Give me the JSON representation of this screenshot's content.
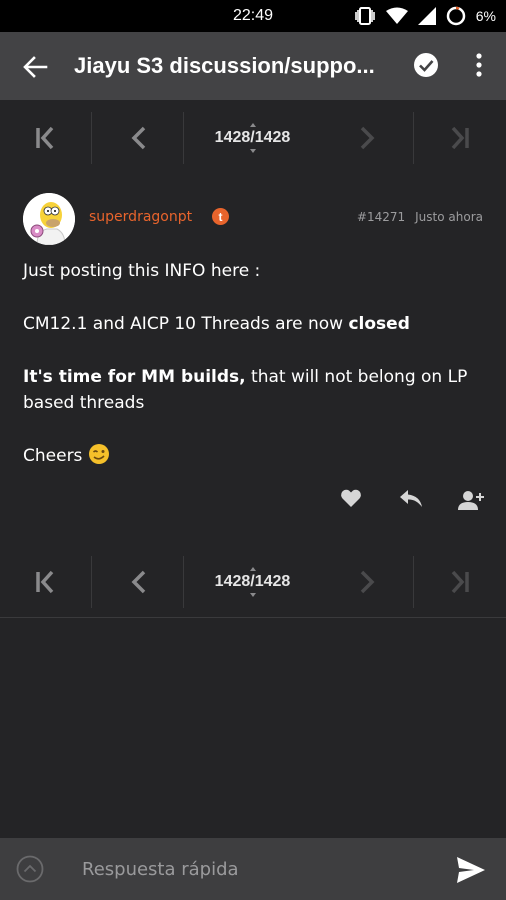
{
  "status_bar": {
    "time": "22:49",
    "battery": "6%",
    "icons": [
      "vibrate-icon",
      "wifi-icon",
      "signal-icon",
      "battery-icon"
    ]
  },
  "app_bar": {
    "title": "Jiayu S3 discussion/suppo...",
    "icons": [
      "back-arrow-icon",
      "check-circle-icon",
      "more-vert-icon"
    ]
  },
  "pager_top": {
    "page_current": "1428",
    "page_total": "1428"
  },
  "pager_bottom": {
    "page_current": "1428",
    "page_total": "1428"
  },
  "post": {
    "author": "superdragonpt",
    "badge": "t",
    "number": "#14271",
    "time": "Justo ahora",
    "line1": "Just posting this INFO here :",
    "line2_pre": "CM12.1 and AICP 10 Threads are now ",
    "line2_bold": "closed",
    "line3_bold": "It's time for MM builds,",
    "line3_rest": " that will not belong on LP based threads",
    "line4": "Cheers",
    "actions": [
      "heart-icon",
      "reply-icon",
      "add-user-icon"
    ]
  },
  "reply": {
    "placeholder": "Respuesta rápida"
  },
  "colors": {
    "accent": "#e8642c",
    "background": "#242426",
    "app_bar": "#434345",
    "reply_bar": "#3e3e40"
  }
}
